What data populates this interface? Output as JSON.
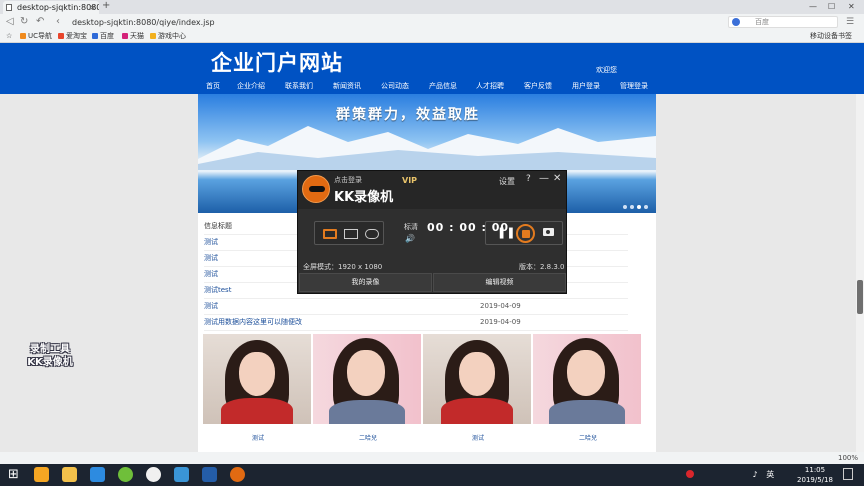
{
  "browser": {
    "tab_title": "desktop-sjqktin:8080",
    "tab_close": "×",
    "new_tab": "+",
    "url": "desktop-sjqktin:8080/qiye/index.jsp",
    "search_placeholder": "百度",
    "window_min": "—",
    "window_max": "☐",
    "window_close": "✕",
    "bookmarks": [
      {
        "label": "UC导航",
        "color": "#f08a1d"
      },
      {
        "label": "爱淘宝",
        "color": "#e8452c"
      },
      {
        "label": "百度",
        "color": "#2f6ad8"
      },
      {
        "label": "天猫",
        "color": "#d4237a"
      },
      {
        "label": "游戏中心",
        "color": "#f2b01e"
      }
    ],
    "mobile_bookmarks": "移动设备书签",
    "status_zoom": "100%"
  },
  "site": {
    "title": "企业门户网站",
    "welcome": "欢迎您",
    "menu": [
      "首页",
      "企业介绍",
      "联系我们",
      "新闻资讯",
      "公司动态",
      "产品信息",
      "人才招聘",
      "客户反馈",
      "用户登录",
      "管理登录"
    ],
    "slogan": "群策群力，效益取胜",
    "info_header": "信息标题",
    "rows": [
      {
        "title": "测试",
        "date": ""
      },
      {
        "title": "测试",
        "date": ""
      },
      {
        "title": "测试",
        "date": ""
      },
      {
        "title": "测试test",
        "date": ""
      },
      {
        "title": "测试",
        "date": "2019-04-09"
      },
      {
        "title": "测试用数据内容这里可以随便改",
        "date": "2019-04-09"
      }
    ],
    "captions": [
      "测试",
      "二哈兒",
      "测试",
      "二哈兒"
    ]
  },
  "watermark": {
    "line1": "录制工具",
    "line2": "KK录像机"
  },
  "kk": {
    "login": "点击登录",
    "vip": "VIP",
    "name": "KK录像机",
    "settings": "设置",
    "help": "?",
    "minimize": "—",
    "close": "✕",
    "quality": "标清",
    "volume": "🔊",
    "time": "00 : 00 : 00",
    "pause": "❚❚",
    "fullscreen": "全屏模式：1920 x 1080",
    "version": "版本：2.8.3.0",
    "my_recordings": "我的录像",
    "edit_video": "编辑视频"
  },
  "taskbar": {
    "clock_time": "11:05",
    "clock_date": "2019/5/18",
    "lang": "英"
  }
}
